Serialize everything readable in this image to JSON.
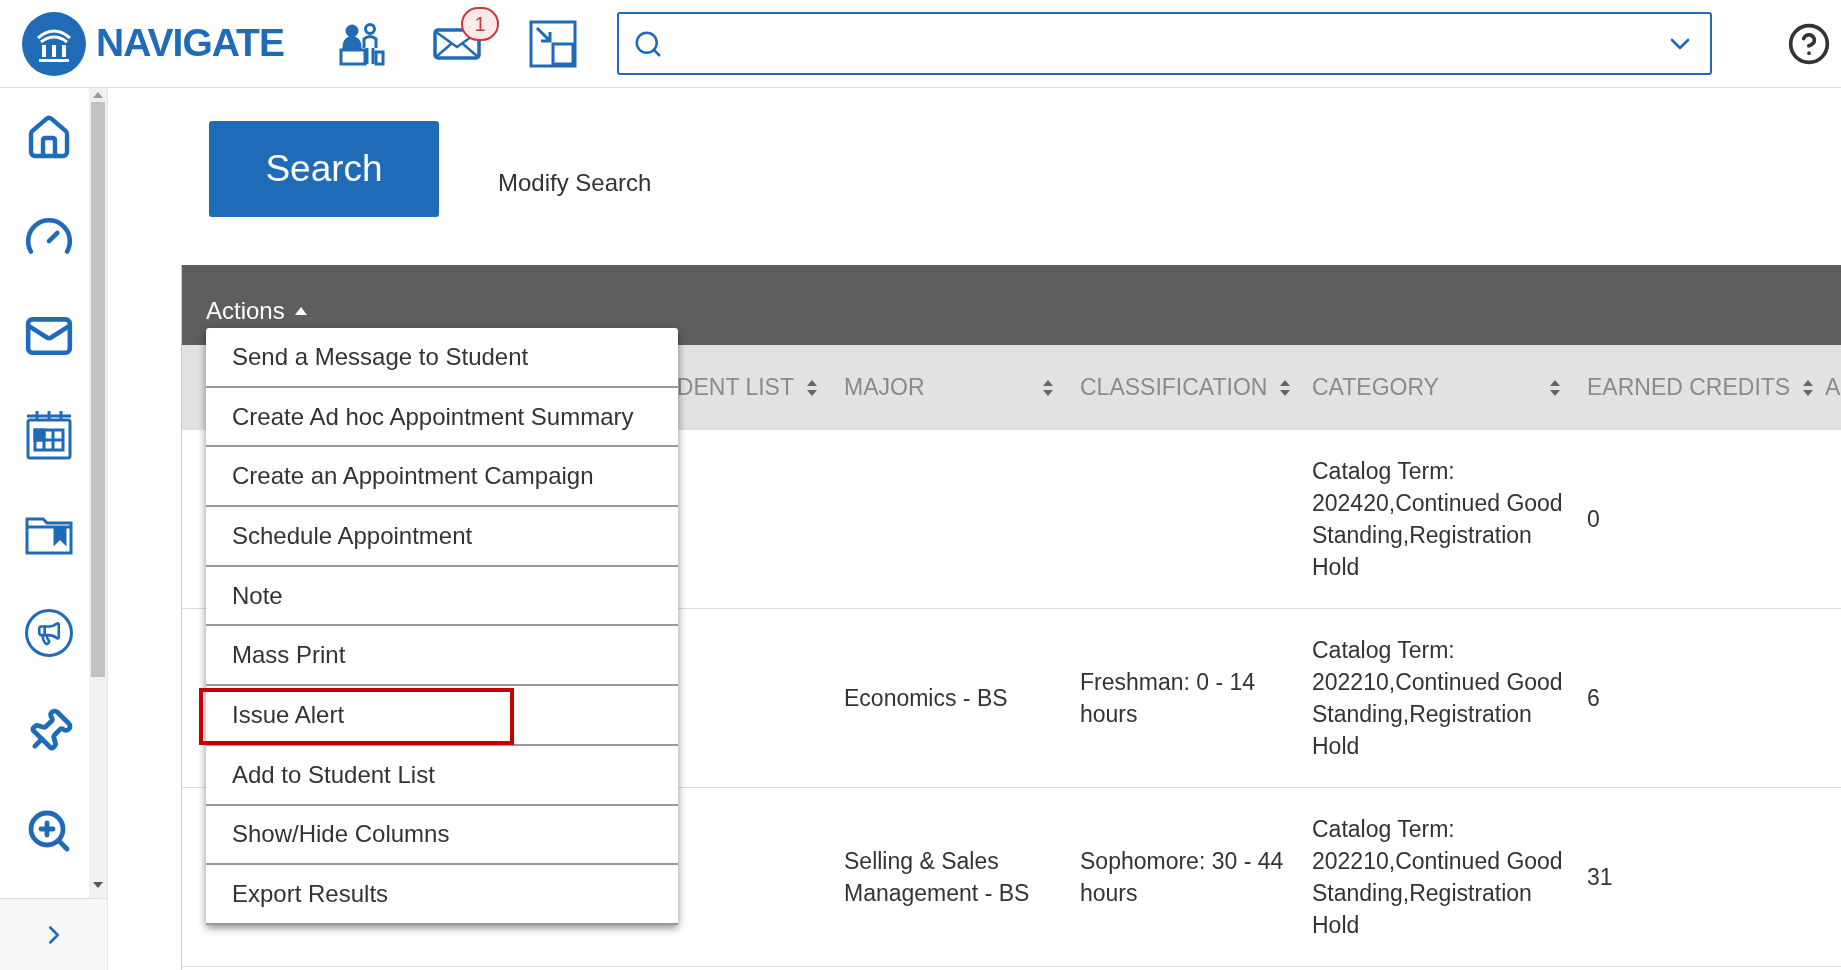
{
  "app": {
    "logo_text": "NAVIGATE",
    "message_badge": "1"
  },
  "search_button": "Search",
  "modify_search": "Modify Search",
  "actions": {
    "label": "Actions",
    "expanded": true,
    "items": [
      {
        "label": "Send a Message to Student",
        "highlighted": false
      },
      {
        "label": "Create Ad hoc Appointment Summary",
        "highlighted": false
      },
      {
        "label": "Create an Appointment Campaign",
        "highlighted": false
      },
      {
        "label": "Schedule Appointment",
        "highlighted": false
      },
      {
        "label": "Note",
        "highlighted": false
      },
      {
        "label": "Mass Print",
        "highlighted": false
      },
      {
        "label": "Issue Alert",
        "highlighted": true
      },
      {
        "label": "Add to Student List",
        "highlighted": false
      },
      {
        "label": "Show/Hide Columns",
        "highlighted": false
      },
      {
        "label": "Export Results",
        "highlighted": false
      }
    ]
  },
  "table": {
    "columns": [
      {
        "label": "DENT LIST",
        "sortable": true
      },
      {
        "label": "MAJOR",
        "sortable": true
      },
      {
        "label": "CLASSIFICATION",
        "sortable": true
      },
      {
        "label": "CATEGORY",
        "sortable": true
      },
      {
        "label": "EARNED CREDITS",
        "sortable": true
      },
      {
        "label": "A",
        "sortable": false
      }
    ],
    "rows": [
      {
        "category": "Catalog Term: 202420,Continued Good Standing,Registration Hold",
        "earned_credits": "0"
      },
      {
        "major": "Economics - BS",
        "classification": "Freshman: 0 - 14 hours",
        "category": "Catalog Term: 202210,Continued Good Standing,Registration Hold",
        "earned_credits": "6"
      },
      {
        "major": "Selling & Sales Management - BS",
        "classification": "Sophomore: 30 - 44 hours",
        "category": "Catalog Term: 202210,Continued Good Standing,Registration Hold",
        "earned_credits": "31"
      }
    ]
  }
}
